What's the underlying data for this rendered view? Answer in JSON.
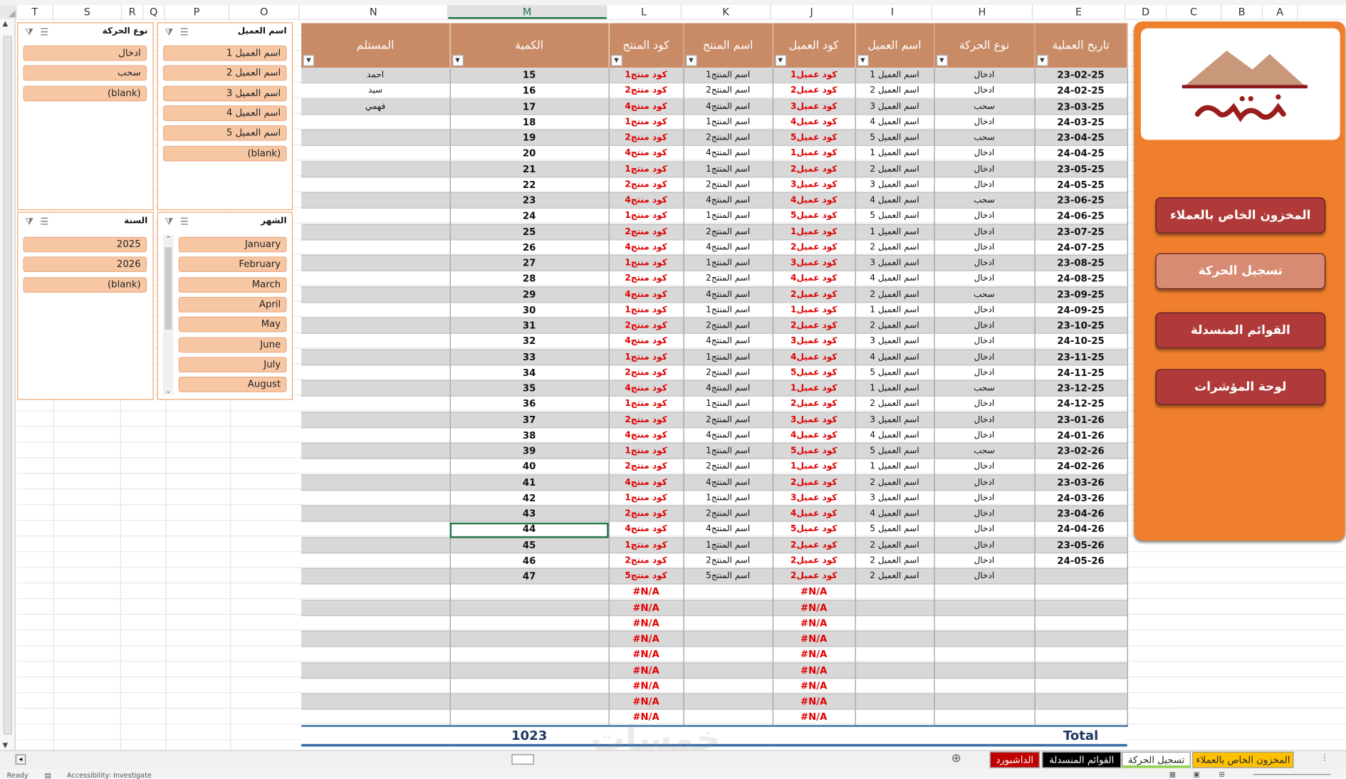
{
  "columns": [
    "T",
    "S",
    "R",
    "Q",
    "P",
    "O",
    "N",
    "M",
    "L",
    "K",
    "J",
    "I",
    "H",
    "E",
    "D",
    "C",
    "B",
    "A"
  ],
  "selected_column": "M",
  "slicers": {
    "client_name": {
      "title": "اسم العميل",
      "items": [
        "اسم العميل 1",
        "اسم العميل 2",
        "اسم العميل 3",
        "اسم العميل 4",
        "اسم العميل 5",
        "(blank)"
      ]
    },
    "movement_type": {
      "title": "نوع الحركة",
      "items": [
        "ادخال",
        "سحب",
        "(blank)"
      ]
    },
    "month": {
      "title": "الشهر",
      "items": [
        "January",
        "February",
        "March",
        "April",
        "May",
        "June",
        "July",
        "August"
      ]
    },
    "year": {
      "title": "السنة",
      "items": [
        "2025",
        "2026",
        "(blank)"
      ]
    }
  },
  "table": {
    "headers": [
      "المستلم",
      "الكمية",
      "كود المنتج",
      "اسم المنتج",
      "كود العميل",
      "اسم العميل",
      "نوع الحركة",
      "تاريخ العملية"
    ],
    "rows": [
      [
        "احمد",
        "15",
        "كود منتج1",
        "اسم المنتج1",
        "كود عميل1",
        "اسم العميل 1",
        "ادخال",
        "23-02-25"
      ],
      [
        "سيد",
        "16",
        "كود منتج2",
        "اسم المنتج2",
        "كود عميل2",
        "اسم العميل 2",
        "ادخال",
        "24-02-25"
      ],
      [
        "فهمي",
        "17",
        "كود منتج4",
        "اسم المنتج4",
        "كود عميل3",
        "اسم العميل 3",
        "سحب",
        "23-03-25"
      ],
      [
        "",
        "18",
        "كود منتج1",
        "اسم المنتج1",
        "كود عميل4",
        "اسم العميل 4",
        "ادخال",
        "24-03-25"
      ],
      [
        "",
        "19",
        "كود منتج2",
        "اسم المنتج2",
        "كود عميل5",
        "اسم العميل 5",
        "سحب",
        "23-04-25"
      ],
      [
        "",
        "20",
        "كود منتج4",
        "اسم المنتج4",
        "كود عميل1",
        "اسم العميل 1",
        "ادخال",
        "24-04-25"
      ],
      [
        "",
        "21",
        "كود منتج1",
        "اسم المنتج1",
        "كود عميل2",
        "اسم العميل 2",
        "ادخال",
        "23-05-25"
      ],
      [
        "",
        "22",
        "كود منتج2",
        "اسم المنتج2",
        "كود عميل3",
        "اسم العميل 3",
        "ادخال",
        "24-05-25"
      ],
      [
        "",
        "23",
        "كود منتج4",
        "اسم المنتج4",
        "كود عميل4",
        "اسم العميل 4",
        "سحب",
        "23-06-25"
      ],
      [
        "",
        "24",
        "كود منتج1",
        "اسم المنتج1",
        "كود عميل5",
        "اسم العميل 5",
        "ادخال",
        "24-06-25"
      ],
      [
        "",
        "25",
        "كود منتج2",
        "اسم المنتج2",
        "كود عميل1",
        "اسم العميل 1",
        "ادخال",
        "23-07-25"
      ],
      [
        "",
        "26",
        "كود منتج4",
        "اسم المنتج4",
        "كود عميل2",
        "اسم العميل 2",
        "ادخال",
        "24-07-25"
      ],
      [
        "",
        "27",
        "كود منتج1",
        "اسم المنتج1",
        "كود عميل3",
        "اسم العميل 3",
        "ادخال",
        "23-08-25"
      ],
      [
        "",
        "28",
        "كود منتج2",
        "اسم المنتج2",
        "كود عميل4",
        "اسم العميل 4",
        "ادخال",
        "24-08-25"
      ],
      [
        "",
        "29",
        "كود منتج4",
        "اسم المنتج4",
        "كود عميل2",
        "اسم العميل 2",
        "سحب",
        "23-09-25"
      ],
      [
        "",
        "30",
        "كود منتج1",
        "اسم المنتج1",
        "كود عميل1",
        "اسم العميل 1",
        "ادخال",
        "24-09-25"
      ],
      [
        "",
        "31",
        "كود منتج2",
        "اسم المنتج2",
        "كود عميل2",
        "اسم العميل 2",
        "ادخال",
        "23-10-25"
      ],
      [
        "",
        "32",
        "كود منتج4",
        "اسم المنتج4",
        "كود عميل3",
        "اسم العميل 3",
        "ادخال",
        "24-10-25"
      ],
      [
        "",
        "33",
        "كود منتج1",
        "اسم المنتج1",
        "كود عميل4",
        "اسم العميل 4",
        "ادخال",
        "23-11-25"
      ],
      [
        "",
        "34",
        "كود منتج2",
        "اسم المنتج2",
        "كود عميل5",
        "اسم العميل 5",
        "ادخال",
        "24-11-25"
      ],
      [
        "",
        "35",
        "كود منتج4",
        "اسم المنتج4",
        "كود عميل1",
        "اسم العميل 1",
        "سحب",
        "23-12-25"
      ],
      [
        "",
        "36",
        "كود منتج1",
        "اسم المنتج1",
        "كود عميل2",
        "اسم العميل 2",
        "ادخال",
        "24-12-25"
      ],
      [
        "",
        "37",
        "كود منتج2",
        "اسم المنتج2",
        "كود عميل3",
        "اسم العميل 3",
        "ادخال",
        "23-01-26"
      ],
      [
        "",
        "38",
        "كود منتج4",
        "اسم المنتج4",
        "كود عميل4",
        "اسم العميل 4",
        "ادخال",
        "24-01-26"
      ],
      [
        "",
        "39",
        "كود منتج1",
        "اسم المنتج1",
        "كود عميل5",
        "اسم العميل 5",
        "سحب",
        "23-02-26"
      ],
      [
        "",
        "40",
        "كود منتج2",
        "اسم المنتج2",
        "كود عميل1",
        "اسم العميل 1",
        "ادخال",
        "24-02-26"
      ],
      [
        "",
        "41",
        "كود منتج4",
        "اسم المنتج4",
        "كود عميل2",
        "اسم العميل 2",
        "ادخال",
        "23-03-26"
      ],
      [
        "",
        "42",
        "كود منتج1",
        "اسم المنتج1",
        "كود عميل3",
        "اسم العميل 3",
        "ادخال",
        "24-03-26"
      ],
      [
        "",
        "43",
        "كود منتج2",
        "اسم المنتج2",
        "كود عميل4",
        "اسم العميل 4",
        "ادخال",
        "23-04-26"
      ],
      [
        "",
        "44",
        "كود منتج4",
        "اسم المنتج4",
        "كود عميل5",
        "اسم العميل 5",
        "ادخال",
        "24-04-26"
      ],
      [
        "",
        "45",
        "كود منتج1",
        "اسم المنتج1",
        "كود عميل2",
        "اسم العميل 2",
        "ادخال",
        "23-05-26"
      ],
      [
        "",
        "46",
        "كود منتج2",
        "اسم المنتج2",
        "كود عميل2",
        "اسم العميل 2",
        "ادخال",
        "24-05-26"
      ],
      [
        "",
        "47",
        "كود منتج5",
        "اسم المنتج5",
        "كود عميل2",
        "اسم العميل 2",
        "ادخال",
        ""
      ]
    ],
    "na_rows": 9,
    "na_text": "#N/A",
    "total_label": "Total",
    "total_value": "1023"
  },
  "nav": {
    "buttons": [
      "المخزون الخاص بالعملاء",
      "تسجيل الحركة",
      "القوائم المنسدلة",
      "لوحة المؤشرات"
    ],
    "active_index": 1
  },
  "sheet_tabs": [
    {
      "label": "المخزون الخاص بالعملاء",
      "color": "#ffc000"
    },
    {
      "label": "تسجيل الحركة",
      "color": "#92d050"
    },
    {
      "label": "القوائم المنسدلة",
      "color": "#000000"
    },
    {
      "label": "الداشبورد",
      "color": "#c00000"
    }
  ],
  "status": {
    "ready": "Ready",
    "accessibility": "Accessibility: Investigate"
  },
  "watermark": "خمسات",
  "colors": {
    "header_bg": "#c98a66",
    "panel": "#f07f2d",
    "button": "#b03a3a",
    "slicer_item": "#f7c7a4",
    "red_text": "#e00000"
  }
}
